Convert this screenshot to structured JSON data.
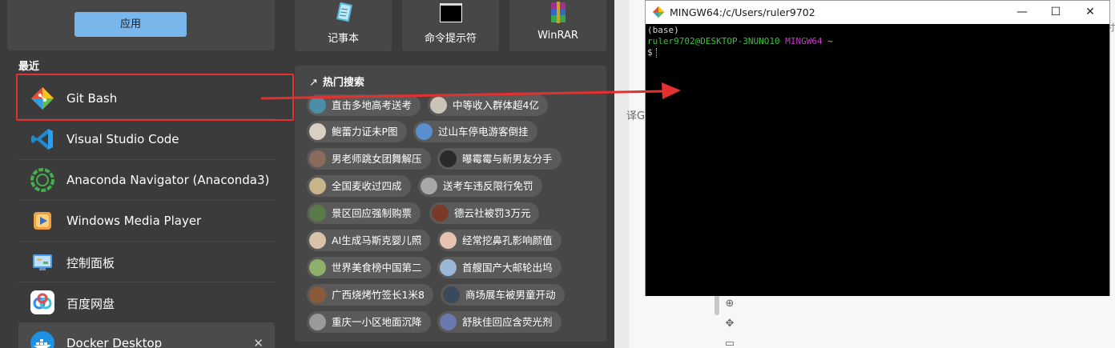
{
  "apply_label": "应用",
  "recent_heading": "最近",
  "recent_items": [
    {
      "label": "Git Bash",
      "icon": "git-icon"
    },
    {
      "label": "Visual Studio Code",
      "icon": "vscode-icon"
    },
    {
      "label": "Anaconda Navigator (Anaconda3)",
      "icon": "anaconda-icon"
    },
    {
      "label": "Windows Media Player",
      "icon": "media-player-icon"
    },
    {
      "label": "控制面板",
      "icon": "control-panel-icon"
    },
    {
      "label": "百度网盘",
      "icon": "baidu-netdisk-icon"
    },
    {
      "label": "Docker Desktop",
      "icon": "docker-icon"
    }
  ],
  "pinned": [
    {
      "label": "记事本",
      "icon": "notepad-icon"
    },
    {
      "label": "命令提示符",
      "icon": "cmd-icon"
    },
    {
      "label": "WinRAR",
      "icon": "winrar-icon"
    }
  ],
  "trending": {
    "title": "热门搜索",
    "items": [
      "直击多地高考送考",
      "中等收入群体超4亿",
      "鲍蕾力证未P图",
      "过山车停电游客倒挂",
      "男老师跳女团舞解压",
      "曝霉霉与新男友分手",
      "全国麦收过四成",
      "送考车违反限行免罚",
      "景区回应强制购票",
      "德云社被罚3万元",
      "AI生成马斯克婴儿照",
      "经常挖鼻孔影响颜值",
      "世界美食榜中国第二",
      "首艘国产大邮轮出坞",
      "广西烧烤竹签长1米8",
      "商场展车被男童开动",
      "重庆一小区地面沉降",
      "舒肤佳回应含荧光剂"
    ]
  },
  "background": {
    "fragment_right": "ホ",
    "fragment_left": "译GF"
  },
  "terminal": {
    "title": "MINGW64:/c/Users/ruler9702",
    "line1": "(base)",
    "user_host": "ruler9702@DESKTOP-3NUNO10",
    "shell": "MINGW64",
    "path": "~",
    "prompt": "$"
  },
  "colors": {
    "highlight": "#e53030",
    "apply_button": "#79b6ec"
  }
}
